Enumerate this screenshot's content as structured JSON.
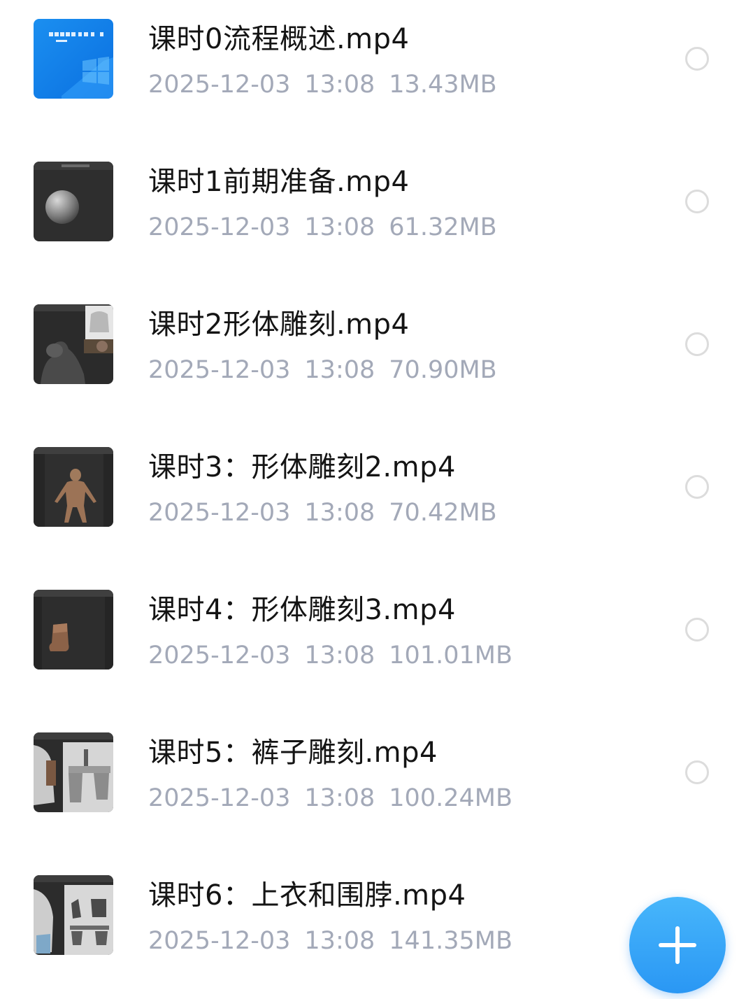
{
  "files": [
    {
      "name": "课时0流程概述.mp4",
      "date": "2025-12-03",
      "time": "13:08",
      "size": "13.43MB",
      "thumb_icon": "windows-desktop-thumbnail"
    },
    {
      "name": "课时1前期准备.mp4",
      "date": "2025-12-03",
      "time": "13:08",
      "size": "61.32MB",
      "thumb_icon": "sphere-sculpt-thumbnail"
    },
    {
      "name": "课时2形体雕刻.mp4",
      "date": "2025-12-03",
      "time": "13:08",
      "size": "70.90MB",
      "thumb_icon": "creature-bust-thumbnail"
    },
    {
      "name": "课时3：形体雕刻2.mp4",
      "date": "2025-12-03",
      "time": "13:08",
      "size": "70.42MB",
      "thumb_icon": "creature-body-thumbnail"
    },
    {
      "name": "课时4：形体雕刻3.mp4",
      "date": "2025-12-03",
      "time": "13:08",
      "size": "101.01MB",
      "thumb_icon": "foot-sculpt-thumbnail"
    },
    {
      "name": "课时5：裤子雕刻.mp4",
      "date": "2025-12-03",
      "time": "13:08",
      "size": "100.24MB",
      "thumb_icon": "pants-sculpt-thumbnail"
    },
    {
      "name": "课时6：上衣和围脖.mp4",
      "date": "2025-12-03",
      "time": "13:08",
      "size": "141.35MB",
      "thumb_icon": "jacket-sculpt-thumbnail"
    }
  ],
  "fab": {
    "icon": "plus-icon"
  },
  "colors": {
    "title": "#141414",
    "meta": "#a3a9b8",
    "radio_border": "#dcdcdc",
    "fab": "#2a97f4"
  }
}
